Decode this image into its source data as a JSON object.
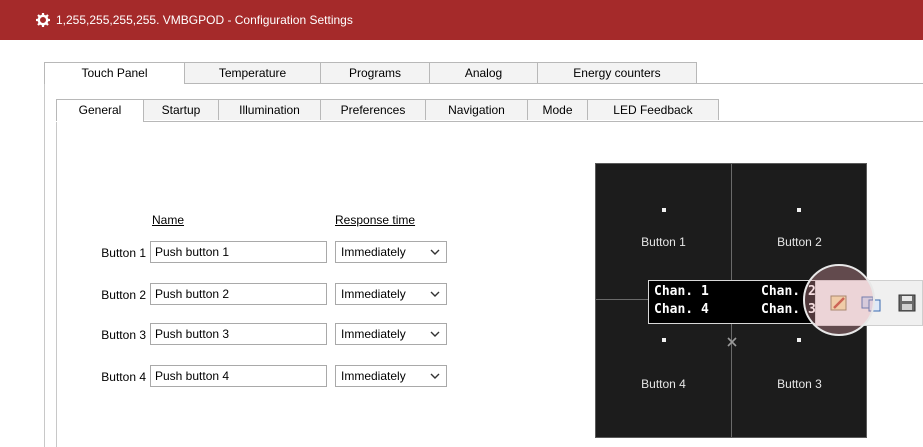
{
  "window": {
    "title": "1,255,255,255,255. VMBGPOD - Configuration Settings",
    "icon": "gear-icon",
    "titlebar_color": "#a52a2a"
  },
  "main_tabs": [
    {
      "label": "Touch Panel",
      "active": true
    },
    {
      "label": "Temperature",
      "active": false
    },
    {
      "label": "Programs",
      "active": false
    },
    {
      "label": "Analog",
      "active": false
    },
    {
      "label": "Energy counters",
      "active": false
    }
  ],
  "sub_tabs": [
    {
      "label": "General",
      "active": true
    },
    {
      "label": "Startup",
      "active": false
    },
    {
      "label": "Illumination",
      "active": false
    },
    {
      "label": "Preferences",
      "active": false
    },
    {
      "label": "Navigation",
      "active": false
    },
    {
      "label": "Mode",
      "active": false
    },
    {
      "label": "LED Feedback",
      "active": false
    }
  ],
  "form": {
    "name_header": "Name",
    "response_header": "Response time",
    "rows": [
      {
        "label": "Button 1",
        "name": "Push button 1",
        "response": "Immediately"
      },
      {
        "label": "Button 2",
        "name": "Push button 2",
        "response": "Immediately"
      },
      {
        "label": "Button 3",
        "name": "Push button 3",
        "response": "Immediately"
      },
      {
        "label": "Button 4",
        "name": "Push button 4",
        "response": "Immediately"
      }
    ]
  },
  "preview": {
    "buttons": [
      "Button 1",
      "Button 2",
      "Button 4",
      "Button 3"
    ],
    "lcd": {
      "line1_left": "Chan. 1",
      "line1_right": "Chan. 2",
      "line2_left": "Chan. 4",
      "line2_right": "Chan. 3"
    },
    "tools": [
      "edit-icon",
      "copy-icon",
      "save-icon"
    ]
  }
}
